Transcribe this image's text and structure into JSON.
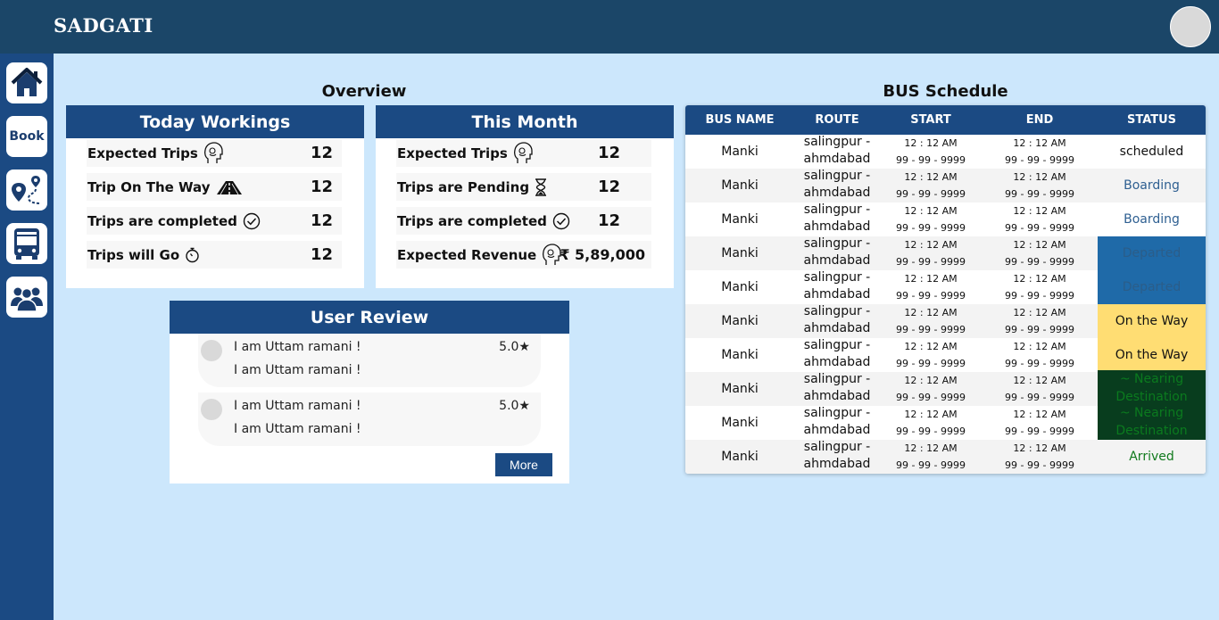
{
  "brand": "SADGATI",
  "sidebar": {
    "items": [
      {
        "icon": "home-icon"
      },
      {
        "label": "Book"
      },
      {
        "icon": "route-map-icon"
      },
      {
        "icon": "bus-icon"
      },
      {
        "icon": "users-icon"
      }
    ]
  },
  "overview": {
    "title": "Overview",
    "today": {
      "title": "Today Workings",
      "stats": [
        {
          "label": "Expected Trips",
          "value": "12",
          "icon": "person-head-icon"
        },
        {
          "label": "Trip On The Way",
          "value": "12",
          "icon": "road-icon"
        },
        {
          "label": "Trips are completed",
          "value": "12",
          "icon": "check-circle-icon"
        },
        {
          "label": "Trips will Go",
          "value": "12",
          "icon": "timer-icon"
        }
      ]
    },
    "month": {
      "title": "This Month",
      "stats": [
        {
          "label": "Expected Trips",
          "value": "12",
          "icon": "person-head-icon"
        },
        {
          "label": "Trips are Pending",
          "value": "12",
          "icon": "hourglass-icon"
        },
        {
          "label": "Trips are completed",
          "value": "12",
          "icon": "check-circle-icon"
        },
        {
          "label": "Expected Revenue",
          "value": "₹ 5,89,000",
          "icon": "person-head-icon"
        }
      ]
    }
  },
  "reviews": {
    "title": "User Review",
    "items": [
      {
        "name": "I am Uttam ramani !",
        "text": "I am Uttam ramani !",
        "rating": "5.0★"
      },
      {
        "name": "I am Uttam ramani !",
        "text": "I am Uttam ramani !",
        "rating": "5.0★"
      }
    ],
    "more_label": "More"
  },
  "schedule": {
    "title": "BUS Schedule",
    "columns": [
      "BUS NAME",
      "ROUTE",
      "START",
      "END",
      "STATUS"
    ],
    "rows": [
      {
        "name": "Manki",
        "route_from": "salingpur -",
        "route_to": "ahmdabad",
        "start_time": "12 : 12 AM",
        "start_date": "99 - 99 - 9999",
        "end_time": "12 : 12 AM",
        "end_date": "99 - 99 - 9999",
        "status": "scheduled",
        "status_color": "#111111",
        "status_bg": "transparent"
      },
      {
        "name": "Manki",
        "route_from": "salingpur -",
        "route_to": "ahmdabad",
        "start_time": "12 : 12 AM",
        "start_date": "99 - 99 - 9999",
        "end_time": "12 : 12 AM",
        "end_date": "99 - 99 - 9999",
        "status": "Boarding",
        "status_color": "#2e5f91",
        "status_bg": "transparent"
      },
      {
        "name": "Manki",
        "route_from": "salingpur -",
        "route_to": "ahmdabad",
        "start_time": "12 : 12 AM",
        "start_date": "99 - 99 - 9999",
        "end_time": "12 : 12 AM",
        "end_date": "99 - 99 - 9999",
        "status": "Boarding",
        "status_color": "#2e5f91",
        "status_bg": "transparent"
      },
      {
        "name": "Manki",
        "route_from": "salingpur -",
        "route_to": "ahmdabad",
        "start_time": "12 : 12 AM",
        "start_date": "99 - 99 - 9999",
        "end_time": "12 : 12 AM",
        "end_date": "99 - 99 - 9999",
        "status": "Departed",
        "status_color": "#2b5d89",
        "status_bg": "#1f6aa8"
      },
      {
        "name": "Manki",
        "route_from": "salingpur -",
        "route_to": "ahmdabad",
        "start_time": "12 : 12 AM",
        "start_date": "99 - 99 - 9999",
        "end_time": "12 : 12 AM",
        "end_date": "99 - 99 - 9999",
        "status": "Departed",
        "status_color": "#2b5d89",
        "status_bg": "#1f6aa8"
      },
      {
        "name": "Manki",
        "route_from": "salingpur -",
        "route_to": "ahmdabad",
        "start_time": "12 : 12 AM",
        "start_date": "99 - 99 - 9999",
        "end_time": "12 : 12 AM",
        "end_date": "99 - 99 - 9999",
        "status": "On the Way",
        "status_color": "#111111",
        "status_bg": "#ffdd73"
      },
      {
        "name": "Manki",
        "route_from": "salingpur -",
        "route_to": "ahmdabad",
        "start_time": "12 : 12 AM",
        "start_date": "99 - 99 - 9999",
        "end_time": "12 : 12 AM",
        "end_date": "99 - 99 - 9999",
        "status": "On the Way",
        "status_color": "#111111",
        "status_bg": "#ffdd73"
      },
      {
        "name": "Manki",
        "route_from": "salingpur -",
        "route_to": "ahmdabad",
        "start_time": "12 : 12 AM",
        "start_date": "99 - 99 - 9999",
        "end_time": "12 : 12 AM",
        "end_date": "99 - 99 - 9999",
        "status": "~ Nearing Destination",
        "status_color": "#0b7a1e",
        "status_bg": "#083d1e"
      },
      {
        "name": "Manki",
        "route_from": "salingpur -",
        "route_to": "ahmdabad",
        "start_time": "12 : 12 AM",
        "start_date": "99 - 99 - 9999",
        "end_time": "12 : 12 AM",
        "end_date": "99 - 99 - 9999",
        "status": "~ Nearing Destination",
        "status_color": "#0b7a1e",
        "status_bg": "#083d1e"
      },
      {
        "name": "Manki",
        "route_from": "salingpur -",
        "route_to": "ahmdabad",
        "start_time": "12 : 12 AM",
        "start_date": "99 - 99 - 9999",
        "end_time": "12 : 12 AM",
        "end_date": "99 - 99 - 9999",
        "status": "Arrived",
        "status_color": "#117a1d",
        "status_bg": "transparent"
      }
    ]
  }
}
